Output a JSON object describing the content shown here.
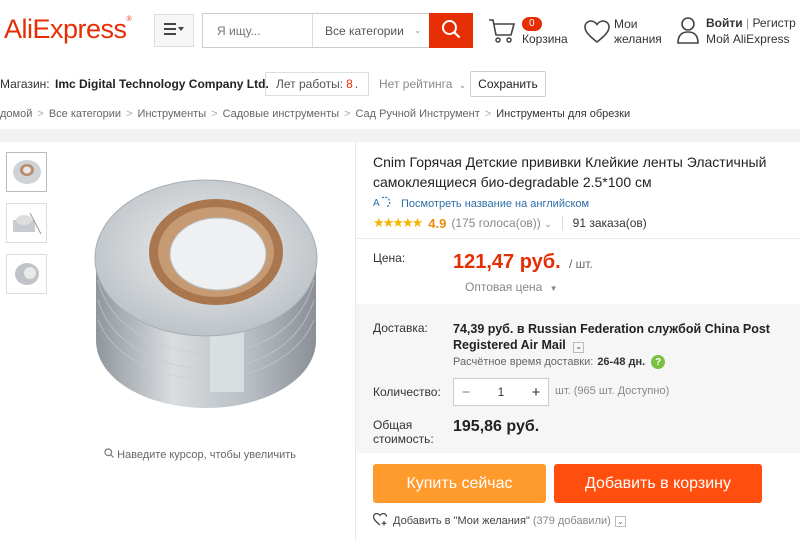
{
  "header": {
    "logo": "AliExpress",
    "logo_mark": "®",
    "search_placeholder": "Я ищу...",
    "search_category": "Все категории",
    "cart_count": "0",
    "cart_label": "Корзина",
    "wishlist_label_1": "Мои",
    "wishlist_label_2": "желания",
    "login": "Войти",
    "register": "Регистр",
    "my_account": "Мой AliExpress",
    "brand_color": "#e62e04"
  },
  "store": {
    "label": "Магазин:",
    "name": "Imc Digital Technology Company Ltd.",
    "years_label": "Лет работы:",
    "years_value": "8",
    "rating": "Нет рейтинга",
    "save": "Сохранить"
  },
  "breadcrumbs": [
    "домой",
    "Все категории",
    "Инструменты",
    "Садовые инструменты",
    "Сад Ручной Инструмент",
    "Инструменты для обрезки"
  ],
  "gallery": {
    "zoom_hint": "Наведите курсор, чтобы увеличить"
  },
  "product": {
    "title": "Cnim Горячая Детские прививки Клейкие ленты Эластичный самоклеящиеся био-degradable 2.5*100 см",
    "translate_link": "Посмотреть название на английском",
    "rating_score": "4.9",
    "votes": "(175 голоса(ов))",
    "orders": "91 заказа(ов)",
    "price_label": "Цена:",
    "price": "121,47 руб.",
    "per_unit": "/ шт.",
    "wholesale": "Оптовая цена",
    "delivery_label": "Доставка:",
    "delivery_text": "74,39 руб. в Russian Federation службой China Post Registered Air Mail",
    "delivery_time_label": "Расчётное время доставки:",
    "delivery_time": "26-48 дн.",
    "quantity_label": "Количество:",
    "quantity": "1",
    "available": "шт. (965 шт. Доступно)",
    "total_label": "Общая стоимость:",
    "total": "195,86 руб.",
    "buy_now": "Купить сейчас",
    "add_to_cart": "Добавить в корзину",
    "add_wishlist": "Добавить в \"Мои желания\"",
    "wishlist_count": "(379 добавили)"
  }
}
